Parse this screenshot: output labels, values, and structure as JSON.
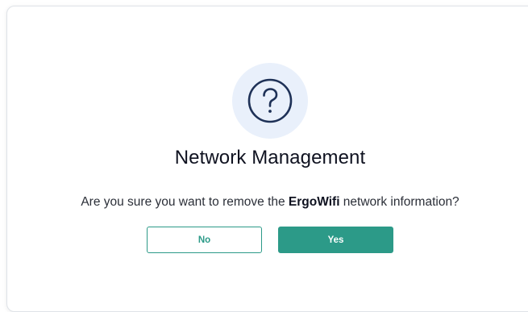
{
  "dialog": {
    "icon": "question-circle-icon",
    "title": "Network Management",
    "message_prefix": "Are you sure you want to remove the ",
    "message_highlight": "ErgoWifi",
    "message_suffix": " network information?",
    "no_label": "No",
    "yes_label": "Yes"
  },
  "colors": {
    "accent": "#2c9a88",
    "icon_bg": "#e9f0fb",
    "icon_stroke": "#1e3157",
    "title_text": "#0f1220"
  }
}
